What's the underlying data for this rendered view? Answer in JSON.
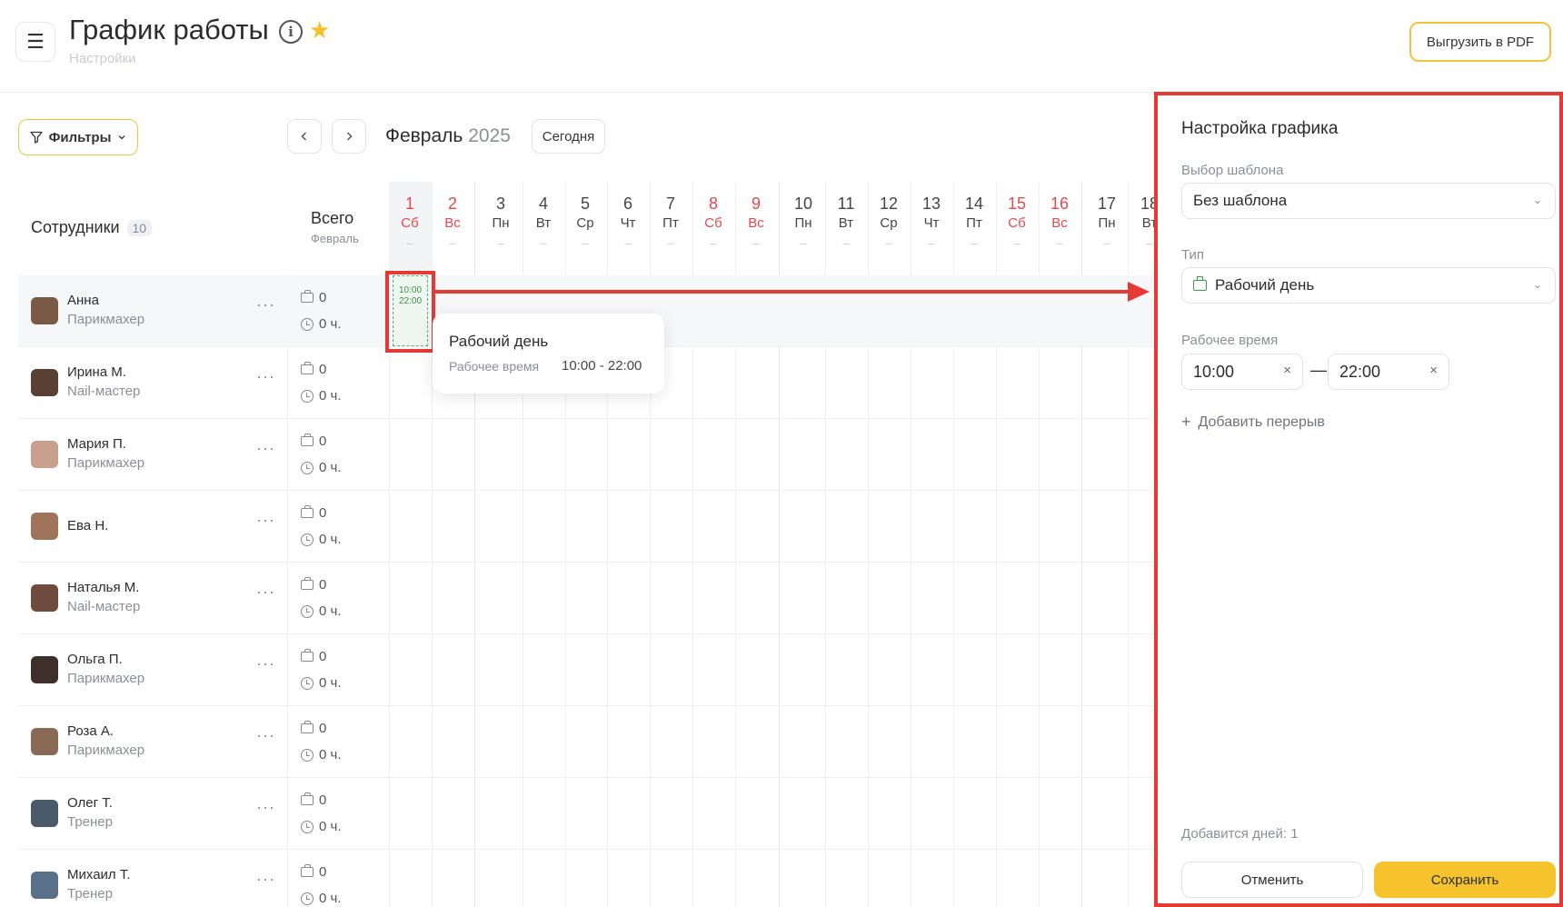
{
  "header": {
    "title": "График работы",
    "breadcrumb": "Настройки",
    "export_pdf_label": "Выгрузить в PDF"
  },
  "toolbar": {
    "filters_label": "Фильтры",
    "month": "Февраль",
    "year": "2025",
    "today_label": "Сегодня"
  },
  "grid": {
    "employees_label": "Сотрудники",
    "employees_count": "10",
    "total_label": "Всего",
    "total_sub": "Февраль",
    "days": [
      {
        "n": "1",
        "w": "Сб",
        "weekend": true
      },
      {
        "n": "2",
        "w": "Вс",
        "weekend": true
      },
      {
        "n": "3",
        "w": "Пн",
        "weekend": false
      },
      {
        "n": "4",
        "w": "Вт",
        "weekend": false
      },
      {
        "n": "5",
        "w": "Ср",
        "weekend": false
      },
      {
        "n": "6",
        "w": "Чт",
        "weekend": false
      },
      {
        "n": "7",
        "w": "Пт",
        "weekend": false
      },
      {
        "n": "8",
        "w": "Сб",
        "weekend": true
      },
      {
        "n": "9",
        "w": "Вс",
        "weekend": true
      },
      {
        "n": "10",
        "w": "Пн",
        "weekend": false
      },
      {
        "n": "11",
        "w": "Вт",
        "weekend": false
      },
      {
        "n": "12",
        "w": "Ср",
        "weekend": false
      },
      {
        "n": "13",
        "w": "Чт",
        "weekend": false
      },
      {
        "n": "14",
        "w": "Пт",
        "weekend": false
      },
      {
        "n": "15",
        "w": "Сб",
        "weekend": true
      },
      {
        "n": "16",
        "w": "Вс",
        "weekend": true
      },
      {
        "n": "17",
        "w": "Пн",
        "weekend": false
      },
      {
        "n": "18",
        "w": "Вт",
        "weekend": false
      }
    ],
    "day_placeholder": "–",
    "employees": [
      {
        "name": "Анна",
        "role": "Парикмахер",
        "shifts": "0",
        "hours": "0 ч."
      },
      {
        "name": "Ирина М.",
        "role": "Nail-мастер",
        "shifts": "0",
        "hours": "0 ч."
      },
      {
        "name": "Мария П.",
        "role": "Парикмахер",
        "shifts": "0",
        "hours": "0 ч."
      },
      {
        "name": "Ева Н.",
        "role": "",
        "shifts": "0",
        "hours": "0 ч."
      },
      {
        "name": "Наталья М.",
        "role": "Nail-мастер",
        "shifts": "0",
        "hours": "0 ч."
      },
      {
        "name": "Ольга П.",
        "role": "Парикмахер",
        "shifts": "0",
        "hours": "0 ч."
      },
      {
        "name": "Роза А.",
        "role": "Парикмахер",
        "shifts": "0",
        "hours": "0 ч."
      },
      {
        "name": "Олег Т.",
        "role": "Тренер",
        "shifts": "0",
        "hours": "0 ч."
      },
      {
        "name": "Михаил Т.",
        "role": "Тренер",
        "shifts": "0",
        "hours": "0 ч."
      }
    ],
    "shift_cell": {
      "start": "10:00",
      "end": "22:00"
    }
  },
  "tooltip": {
    "title": "Рабочий день",
    "label": "Рабочее время",
    "value": "10:00 - 22:00"
  },
  "panel": {
    "title": "Настройка графика",
    "template_label": "Выбор шаблона",
    "template_value": "Без шаблона",
    "type_label": "Тип",
    "type_value": "Рабочий день",
    "time_label": "Рабочее время",
    "time_start": "10:00",
    "time_end": "22:00",
    "add_break_label": "Добавить перерыв",
    "days_note": "Добавится дней: 1",
    "cancel_label": "Отменить",
    "save_label": "Сохранить"
  },
  "colors": {
    "accent": "#f5c42c",
    "weekend": "#e5484d",
    "highlight": "#e53935",
    "shift_green": "#3d9a4f"
  },
  "icons": [
    "menu-icon",
    "info-icon",
    "star-icon",
    "filter-icon",
    "chevron-down-icon",
    "chevron-left-icon",
    "chevron-right-icon",
    "briefcase-icon",
    "clock-icon",
    "more-icon",
    "close-icon",
    "plus-icon"
  ]
}
